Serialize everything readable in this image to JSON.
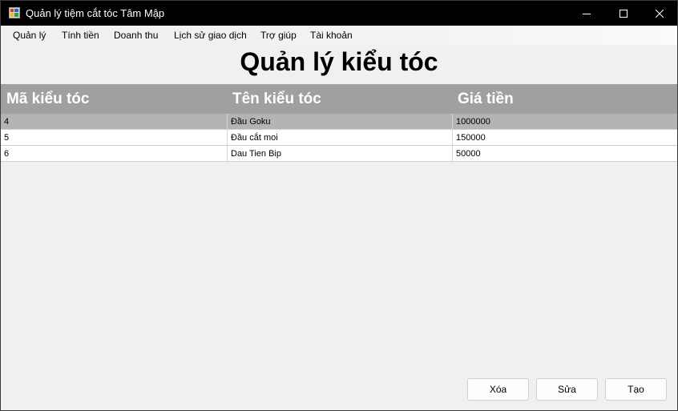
{
  "window": {
    "title": "Quản lý tiệm cắt tóc Tâm Mập"
  },
  "menu": [
    "Quản lý",
    "Tính tiền",
    "Doanh thu",
    "Lịch sử giao dịch",
    "Trợ giúp",
    "Tài khoản"
  ],
  "page": {
    "title": "Quản lý kiểu tóc"
  },
  "table": {
    "columns": [
      "Mã kiểu tóc",
      "Tên kiểu tóc",
      "Giá tiền"
    ],
    "rows": [
      [
        "4",
        "Đầu Goku",
        "1000000"
      ],
      [
        "5",
        "Đầu cắt moi",
        "150000"
      ],
      [
        "6",
        "Dau Tien Bip",
        "50000"
      ]
    ],
    "selected_row": 0
  },
  "buttons": {
    "delete": "Xóa",
    "edit": "Sửa",
    "create": "Tạo"
  },
  "colors": {
    "titlebar": "#000000",
    "grid_header": "#a0a0a0",
    "selected_row": "#b4b4b4"
  }
}
